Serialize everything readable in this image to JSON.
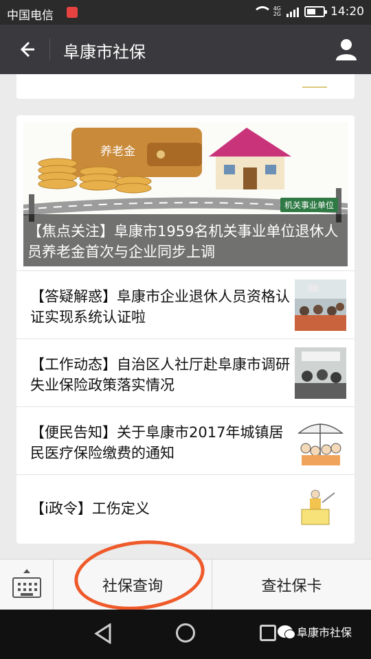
{
  "status": {
    "carrier": "中国电信",
    "network": "4G\n2G",
    "time": "14:20"
  },
  "header": {
    "title": "阜康市社保"
  },
  "hero": {
    "tag": "机关事业单位",
    "badge": "养老金",
    "caption": "【焦点关注】阜康市1959名机关事业单位退休人员养老金首次与企业同步上调"
  },
  "articles": [
    {
      "title": "【答疑解惑】阜康市企业退休人员资格认证实现系统认证啦",
      "thumb": "meeting-photo"
    },
    {
      "title": "【工作动态】自治区人社厅赴阜康市调研失业保险政策落实情况",
      "thumb": "meeting-photo"
    },
    {
      "title": "【便民告知】关于阜康市2017年城镇居民医疗保险缴费的通知",
      "thumb": "umbrella-cartoon"
    },
    {
      "title": "【i政令】工伤定义",
      "thumb": "worker-sign-cartoon"
    }
  ],
  "menu": {
    "btn1": "社保查询",
    "btn2": "查社保卡"
  },
  "watermark": {
    "text": "阜康市社保"
  },
  "colors": {
    "header": "#3a3a3e",
    "highlight_circle": "#ef5a2a"
  }
}
